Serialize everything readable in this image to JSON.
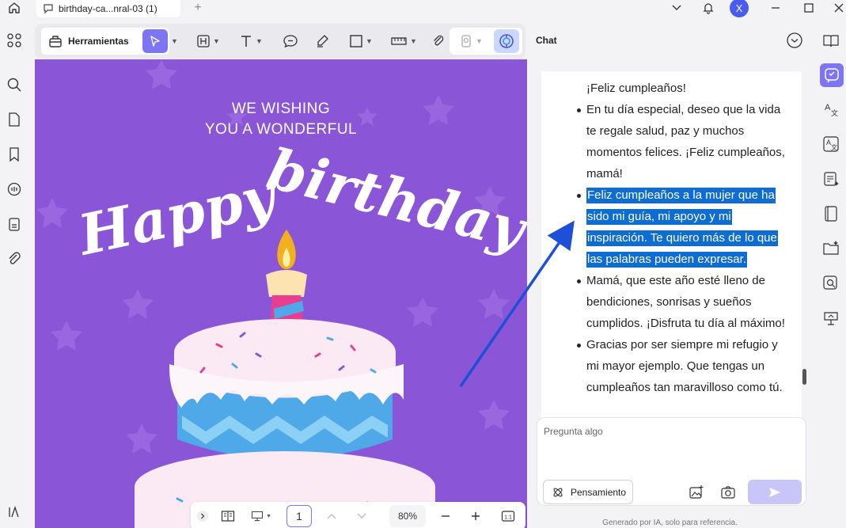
{
  "titlebar": {
    "tab_label": "birthday-ca...nral-03 (1)",
    "avatar_letter": "X"
  },
  "toolbar": {
    "tools_label": "Herramientas"
  },
  "document": {
    "heading_line1": "WE WISHING",
    "heading_line2": "YOU A WONDERFUL",
    "script_text": "Happy birthday"
  },
  "bottombar": {
    "page_number": "1",
    "zoom": "80%"
  },
  "chat": {
    "title": "Chat",
    "lines": [
      {
        "text": "¡Feliz cumpleaños!",
        "bullet": false,
        "highlighted": false
      },
      {
        "text": "En tu día especial, deseo que la vida",
        "bullet": true,
        "highlighted": false
      },
      {
        "text": "te regale salud, paz y muchos",
        "bullet": false,
        "highlighted": false
      },
      {
        "text": "momentos felices. ¡Feliz cumpleaños,",
        "bullet": false,
        "highlighted": false
      },
      {
        "text": "mamá!",
        "bullet": false,
        "highlighted": false
      },
      {
        "text": "Feliz cumpleaños a la mujer que ha",
        "bullet": true,
        "highlighted": true
      },
      {
        "text": "sido mi guía, mi apoyo y mi",
        "bullet": false,
        "highlighted": true
      },
      {
        "text": "inspiración. Te quiero más de lo que",
        "bullet": false,
        "highlighted": true
      },
      {
        "text": "las palabras pueden expresar.",
        "bullet": false,
        "highlighted": true
      },
      {
        "text": "Mamá, que este año esté lleno de",
        "bullet": true,
        "highlighted": false
      },
      {
        "text": "bendiciones, sonrisas y sueños",
        "bullet": false,
        "highlighted": false
      },
      {
        "text": "cumplidos. ¡Disfruta tu día al máximo!",
        "bullet": false,
        "highlighted": false
      },
      {
        "text": "Gracias por ser siempre mi refugio y",
        "bullet": true,
        "highlighted": false
      },
      {
        "text": "mi mayor ejemplo. Que tengas un",
        "bullet": false,
        "highlighted": false
      },
      {
        "text": "cumpleaños tan maravilloso como tú.",
        "bullet": false,
        "highlighted": false
      }
    ],
    "input_placeholder": "Pregunta algo",
    "thinking_label": "Pensamiento",
    "footnote": "Generado por IA, solo para referencia."
  },
  "colors": {
    "accent": "#7e75f5",
    "document_bg": "#8a55d6",
    "highlight": "#0d6dd3",
    "arrow": "#1d4fd8"
  }
}
